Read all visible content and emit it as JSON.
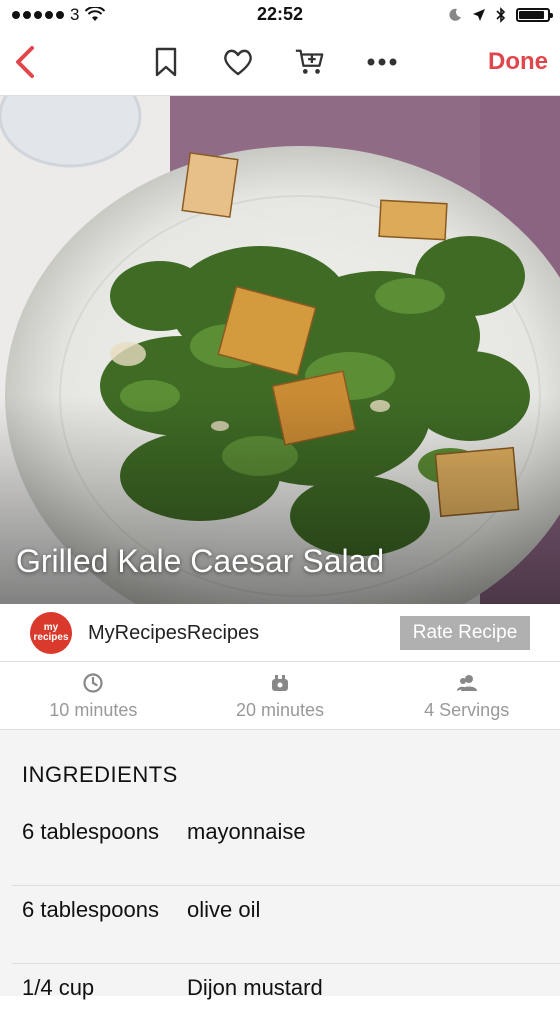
{
  "status_bar": {
    "carrier": "3",
    "time": "22:52",
    "battery_level": 0.9
  },
  "nav": {
    "done_label": "Done",
    "icons": [
      "back-chevron-icon",
      "bookmark-icon",
      "heart-icon",
      "add-to-cart-icon",
      "more-icon"
    ]
  },
  "recipe": {
    "title": "Grilled Kale Caesar Salad",
    "source": "MyRecipesRecipes",
    "source_logo_text": "my recipes",
    "rate_label": "Rate Recipe"
  },
  "meta": {
    "prep_time": "10 minutes",
    "cook_time": "20 minutes",
    "servings": "4 Servings"
  },
  "ingredients": {
    "title": "INGREDIENTS",
    "items": [
      {
        "qty": "6 tablespoons",
        "name": "mayonnaise"
      },
      {
        "qty": "6 tablespoons",
        "name": "olive oil"
      },
      {
        "qty": "1/4 cup",
        "name": "Dijon mustard"
      }
    ]
  },
  "colors": {
    "accent": "#e0474c",
    "rate_button": "#b0b0b0",
    "muted_text": "#999999"
  }
}
